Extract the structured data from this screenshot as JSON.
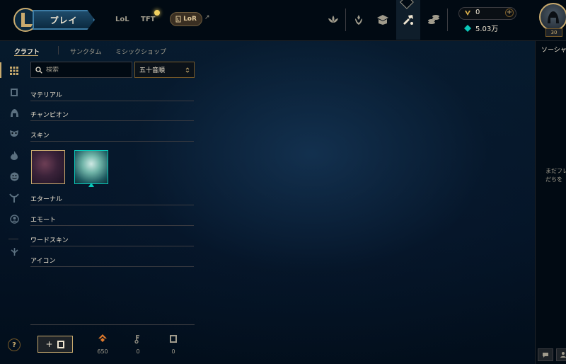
{
  "topbar": {
    "play_label": "プレイ",
    "nav": [
      "LoL",
      "TFT"
    ],
    "lor_label": "LoR",
    "ext_arrow": "↗",
    "icons": [
      "lotus-icon",
      "rank-icon",
      "collection-icon",
      "crafting-icon",
      "store-icon"
    ],
    "active_icon": "crafting-icon",
    "currency": {
      "rp": "0",
      "be": "5.03万"
    },
    "level": "30"
  },
  "subnav": {
    "tabs": [
      "クラフト",
      "サンクタム",
      "ミシックショップ"
    ],
    "active": "クラフト"
  },
  "rail": {
    "icons": [
      "grid-icon",
      "chest-icon",
      "helmet-icon",
      "mask-icon",
      "flame-icon",
      "emote-icon",
      "ward-icon",
      "profile-icon",
      "rune-icon"
    ],
    "help": "?"
  },
  "filters": {
    "search_placeholder": "検索",
    "sort_value": "五十音順",
    "sort_chevron": "⌃⌄"
  },
  "categories": {
    "material": "マテリアル",
    "champion": "チャンピオン",
    "skin": "スキン",
    "eternal": "エターナル",
    "emote": "エモート",
    "ward_skin": "ワードスキン",
    "icon": "アイコン"
  },
  "bottom": {
    "add_chest_label": "+",
    "essence": "650",
    "keys": "0",
    "chests": "0"
  },
  "social": {
    "title": "ソーシャル",
    "message_line1": "まだフレ",
    "message_line2": "だちを"
  },
  "colors": {
    "gold": "#c8aa6e",
    "teal": "#0ac8b9",
    "background": "#010a13"
  }
}
